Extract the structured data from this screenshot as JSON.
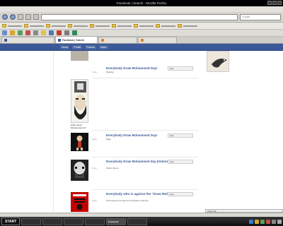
{
  "window": {
    "title": "Facebook | Search - Mozilla Firefox"
  },
  "menu": [
    {
      "label": ""
    },
    {
      "label": ""
    },
    {
      "label": ""
    },
    {
      "label": ""
    },
    {
      "label": ""
    },
    {
      "label": ""
    },
    {
      "label": ""
    }
  ],
  "nav": {
    "url": "",
    "search_placeholder": "Google"
  },
  "bookmarks": [
    {
      "label": ""
    },
    {
      "label": ""
    },
    {
      "label": ""
    },
    {
      "label": ""
    },
    {
      "label": ""
    },
    {
      "label": ""
    },
    {
      "label": ""
    },
    {
      "label": ""
    },
    {
      "label": ""
    }
  ],
  "tabs": [
    {
      "label": "",
      "active": false
    },
    {
      "label": "Facebook | Search",
      "active": true
    },
    {
      "label": "",
      "active": false
    },
    {
      "label": "",
      "active": false
    }
  ],
  "fb": {
    "nav": [
      "Home",
      "Profile",
      "Friends",
      "Inbox"
    ],
    "right": ""
  },
  "results": [
    {
      "caption": "",
      "title": "Everybody Draw Mohammed Day!",
      "type_label": "Type:",
      "type": "Website",
      "likes": "",
      "like_btn": "Like"
    },
    {
      "caption": "What would Muhammad do?",
      "title": "",
      "type_label": "",
      "type": "",
      "likes": "",
      "like_btn": ""
    },
    {
      "caption": "",
      "title": "Everybody Draw Mohammed Day!",
      "type_label": "Type:",
      "type": "Page",
      "likes": "",
      "like_btn": "Like"
    },
    {
      "caption": "",
      "title": "Everybody Draw Mohammed day (Indonesian version)",
      "type_label": "Type:",
      "type": "Public Figure",
      "likes": "",
      "like_btn": "Like"
    },
    {
      "caption": "",
      "title": "Everybody who is against the \"Draw Mohammed Day\"",
      "type_label": "Type:",
      "type": "Technology and Telecommunications Service",
      "likes": "",
      "like_btn": "Like"
    }
  ],
  "right": {
    "caption": ""
  },
  "chat": {
    "label": "Chat (10)"
  },
  "taskbar": {
    "start": "START",
    "tasks": [
      {
        "label": "",
        "active": false
      },
      {
        "label": "",
        "active": false
      },
      {
        "label": "",
        "active": false
      },
      {
        "label": "",
        "active": false
      },
      {
        "label": "Facebook",
        "active": true
      },
      {
        "label": "",
        "active": false
      }
    ]
  },
  "colors": {
    "facebook_blue": "#3b5998",
    "link_blue": "#3b5998",
    "titlebar": "#000000"
  }
}
